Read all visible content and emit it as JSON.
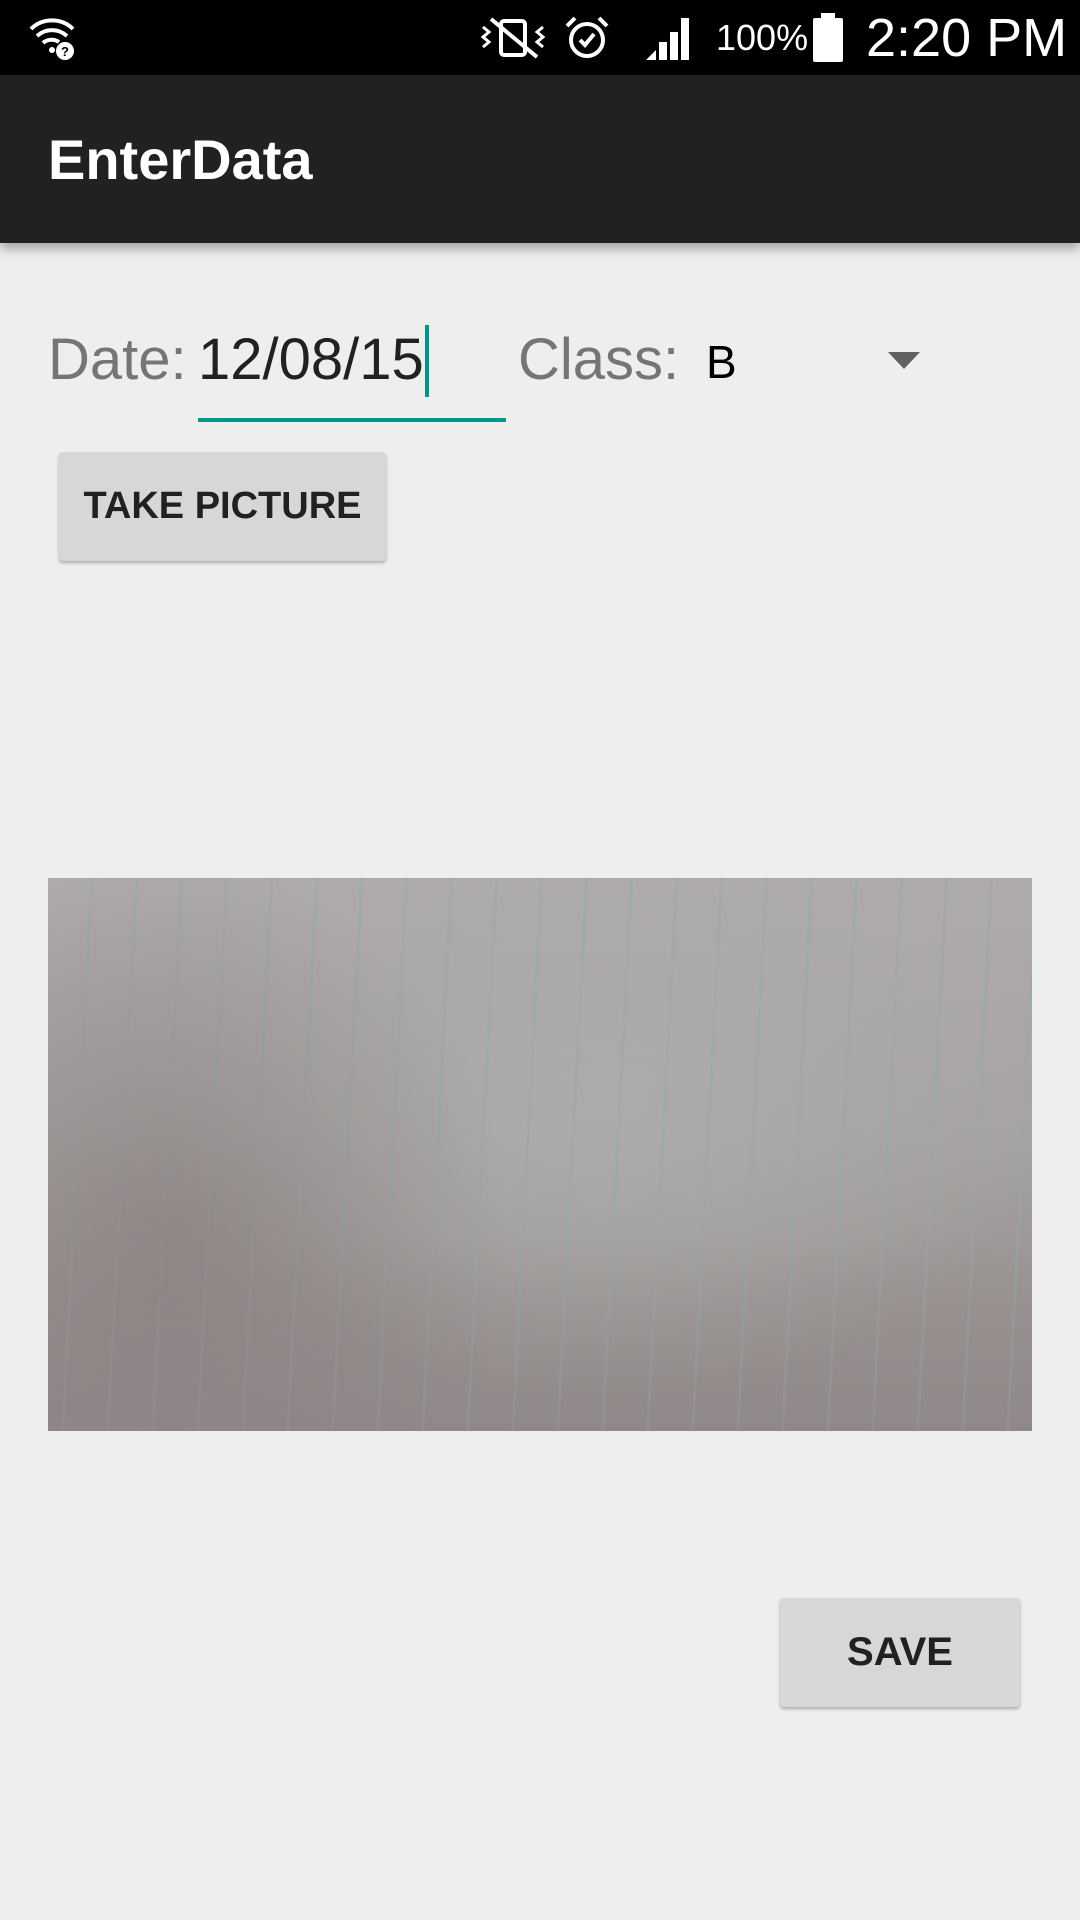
{
  "status_bar": {
    "battery_percent": "100%",
    "time": "2:20 PM",
    "icons": [
      "wifi-question-icon",
      "vibrate-off-icon",
      "alarm-icon",
      "signal-icon",
      "battery-icon"
    ]
  },
  "app_bar": {
    "title": "EnterData"
  },
  "form": {
    "date_label": "Date:",
    "date_value": "12/08/15",
    "class_label": "Class:",
    "class_value": "B"
  },
  "buttons": {
    "take_picture": "TAKE PICTURE",
    "save": "SAVE"
  },
  "colors": {
    "app_bar": "#212121",
    "accent": "#009688",
    "background": "#eeeeee",
    "button": "#d6d7d7"
  }
}
